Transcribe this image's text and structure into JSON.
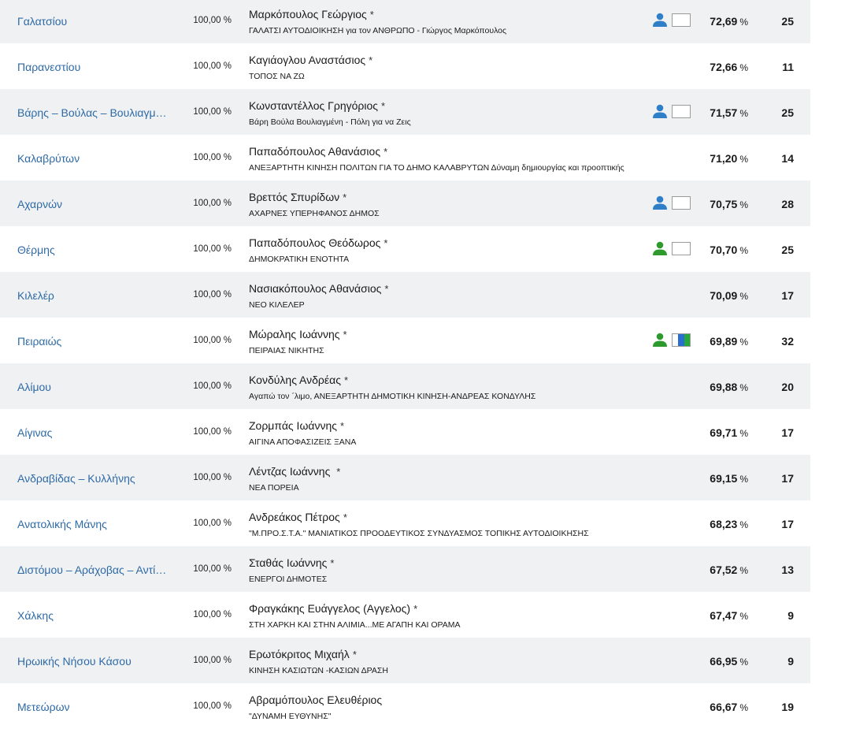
{
  "colors": {
    "link": "#2e6aa6",
    "row_shade": "#f0f1f3",
    "icon_blue": "#2f7fc8",
    "icon_green": "#2e9a2e"
  },
  "rows": [
    {
      "municipality": "Γαλατσίου",
      "counted": "100,00 %",
      "candidate": "Μαρκόπουλος Γεώργιος",
      "star": "*",
      "party": "ΓΑΛΑΤΣΙ ΑΥΤΟΔΙΟΙΚΗΣΗ για τον ΑΝΘΡΩΠΟ - Γιώργος Μαρκόπουλος",
      "icon": "person-icon",
      "icon_color": "blue",
      "flag": "blank",
      "percent": "72,69",
      "pct_sign": "%",
      "seats": "25"
    },
    {
      "municipality": "Παρανεστίου",
      "counted": "100,00 %",
      "candidate": "Καγιάογλου Αναστάσιος",
      "star": "*",
      "party": "ΤΟΠΟΣ ΝΑ ΖΩ",
      "icon": "",
      "icon_color": "",
      "flag": "",
      "percent": "72,66",
      "pct_sign": "%",
      "seats": "11"
    },
    {
      "municipality": "Βάρης – Βούλας – Βουλιαγμένης",
      "counted": "100,00 %",
      "candidate": "Κωνσταντέλλος Γρηγόριος",
      "star": "*",
      "party": "Βάρη Βούλα Βουλιαγμένη - Πόλη για να Ζεις",
      "icon": "person-icon",
      "icon_color": "blue",
      "flag": "blank",
      "percent": "71,57",
      "pct_sign": "%",
      "seats": "25"
    },
    {
      "municipality": "Καλαβρύτων",
      "counted": "100,00 %",
      "candidate": "Παπαδόπουλος Αθανάσιος",
      "star": "*",
      "party": "ΑΝΕΞΑΡΤΗΤΗ ΚΙΝΗΣΗ ΠΟΛΙΤΩΝ ΓΙΑ ΤΟ ΔΗΜΟ ΚΑΛΑΒΡΥΤΩΝ Δύναμη δημιουργίας και προοπτικής",
      "icon": "",
      "icon_color": "",
      "flag": "",
      "percent": "71,20",
      "pct_sign": "%",
      "seats": "14"
    },
    {
      "municipality": "Αχαρνών",
      "counted": "100,00 %",
      "candidate": "Βρεττός Σπυρίδων",
      "star": "*",
      "party": "ΑΧΑΡΝΕΣ ΥΠΕΡΗΦΑΝΟΣ ΔΗΜΟΣ",
      "icon": "person-icon",
      "icon_color": "blue",
      "flag": "blank",
      "percent": "70,75",
      "pct_sign": "%",
      "seats": "28"
    },
    {
      "municipality": "Θέρμης",
      "counted": "100,00 %",
      "candidate": "Παπαδόπουλος Θεόδωρος",
      "star": "*",
      "party": "ΔΗΜΟΚΡΑΤΙΚΗ ΕΝΟΤΗΤΑ",
      "icon": "person-icon",
      "icon_color": "green",
      "flag": "blank",
      "percent": "70,70",
      "pct_sign": "%",
      "seats": "25"
    },
    {
      "municipality": "Κιλελέρ",
      "counted": "100,00 %",
      "candidate": "Νασιακόπουλος Αθανάσιος",
      "star": "*",
      "party": "ΝΕΟ ΚΙΛΕΛΕΡ",
      "icon": "",
      "icon_color": "",
      "flag": "",
      "percent": "70,09",
      "pct_sign": "%",
      "seats": "17"
    },
    {
      "municipality": "Πειραιώς",
      "counted": "100,00 %",
      "candidate": "Μώραλης Ιωάννης",
      "star": "*",
      "party": "ΠΕΙΡΑΙΑΣ ΝΙΚΗΤΗΣ",
      "icon": "person-icon",
      "icon_color": "green",
      "flag": "tricolor",
      "percent": "69,89",
      "pct_sign": "%",
      "seats": "32"
    },
    {
      "municipality": "Αλίμου",
      "counted": "100,00 %",
      "candidate": "Κονδύλης Ανδρέας",
      "star": "*",
      "party": "Αγαπώ τον ΄λιμο, ΑΝΕΞΑΡΤΗΤΗ ΔΗΜΟΤΙΚΗ ΚΙΝΗΣΗ-ΑΝΔΡΕΑΣ ΚΟΝΔΥΛΗΣ",
      "icon": "",
      "icon_color": "",
      "flag": "",
      "percent": "69,88",
      "pct_sign": "%",
      "seats": "20"
    },
    {
      "municipality": "Αίγινας",
      "counted": "100,00 %",
      "candidate": "Ζορμπάς Ιωάννης",
      "star": "*",
      "party": "ΑΙΓΙΝΑ ΑΠΟΦΑΣΙΖΕΙΣ ΞΑΝΑ",
      "icon": "",
      "icon_color": "",
      "flag": "",
      "percent": "69,71",
      "pct_sign": "%",
      "seats": "17"
    },
    {
      "municipality": "Ανδραβίδας – Κυλλήνης",
      "counted": "100,00 %",
      "candidate": "Λέντζας Ιωάννης ",
      "star": "*",
      "party": "ΝΕΑ ΠΟΡΕΙΑ",
      "icon": "",
      "icon_color": "",
      "flag": "",
      "percent": "69,15",
      "pct_sign": "%",
      "seats": "17"
    },
    {
      "municipality": "Ανατολικής Μάνης",
      "counted": "100,00 %",
      "candidate": "Ανδρεάκος Πέτρος",
      "star": "*",
      "party": "\"Μ.ΠΡΟ.Σ.Τ.Α.\" ΜΑΝΙΑΤΙΚΟΣ ΠΡΟΟΔΕΥΤΙΚΟΣ ΣΥΝΔΥΑΣΜΟΣ ΤΟΠΙΚΗΣ ΑΥΤΟΔΙΟΙΚΗΣΗΣ",
      "icon": "",
      "icon_color": "",
      "flag": "",
      "percent": "68,23",
      "pct_sign": "%",
      "seats": "17"
    },
    {
      "municipality": "Διστόμου – Αράχοβας – Αντίκυρας",
      "counted": "100,00 %",
      "candidate": "Σταθάς Ιωάννης",
      "star": "*",
      "party": "ΕΝΕΡΓΟΙ ΔΗΜΟΤΕΣ",
      "icon": "",
      "icon_color": "",
      "flag": "",
      "percent": "67,52",
      "pct_sign": "%",
      "seats": "13"
    },
    {
      "municipality": "Χάλκης",
      "counted": "100,00 %",
      "candidate": "Φραγκάκης Ευάγγελος (Αγγελος)",
      "star": "*",
      "party": "ΣΤΗ ΧΑΡΚΗ ΚΑΙ ΣΤΗΝ ΑΛΙΜΙΑ...ΜΕ ΑΓΑΠΗ ΚΑΙ ΟΡΑΜΑ",
      "icon": "",
      "icon_color": "",
      "flag": "",
      "percent": "67,47",
      "pct_sign": "%",
      "seats": "9"
    },
    {
      "municipality": "Ηρωικής Νήσου Κάσου",
      "counted": "100,00 %",
      "candidate": "Ερωτόκριτος Μιχαήλ",
      "star": "*",
      "party": "ΚΙΝΗΣΗ ΚΑΣΙΩΤΩΝ -ΚΑΣΙΩΝ ΔΡΑΣΗ",
      "icon": "",
      "icon_color": "",
      "flag": "",
      "percent": "66,95",
      "pct_sign": "%",
      "seats": "9"
    },
    {
      "municipality": "Μετεώρων",
      "counted": "100,00 %",
      "candidate": "Αβραμόπουλος Ελευθέριος",
      "star": "",
      "party": "\"ΔΥΝΑΜΗ ΕΥΘΥΝΗΣ\"",
      "icon": "",
      "icon_color": "",
      "flag": "",
      "percent": "66,67",
      "pct_sign": "%",
      "seats": "19"
    }
  ]
}
